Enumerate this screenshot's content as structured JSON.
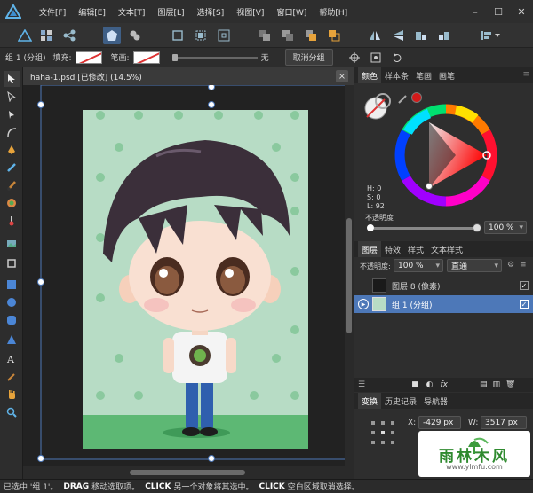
{
  "menu": {
    "items": [
      "文件[F]",
      "编辑[E]",
      "文本[T]",
      "图层[L]",
      "选择[S]",
      "视图[V]",
      "窗口[W]",
      "帮助[H]"
    ],
    "minimize": "–",
    "maximize": "☐",
    "close": "✕"
  },
  "context": {
    "group_label": "组 1 (分组)",
    "fill_label": "填充:",
    "stroke_label": "笔画:",
    "stroke_value": "无",
    "ungroup_button": "取消分组"
  },
  "document": {
    "tab_title": "haha-1.psd [已修改] (14.5%)",
    "close": "×"
  },
  "status": {
    "part1": "已选中 '组 1'。",
    "drag": "DRAG",
    "part2": "移动选取项。",
    "click1": "CLICK",
    "part3": "另一个对象将其选中。",
    "click2": "CLICK",
    "part4": "空白区域取消选择。"
  },
  "color_panel": {
    "tabs": [
      "颜色",
      "样本条",
      "笔画",
      "画笔"
    ],
    "h": "H: 0",
    "s": "S: 0",
    "l": "L: 92",
    "opacity_label": "不透明度",
    "opacity_value": "100 %",
    "opacity_level": 1.0
  },
  "layers_panel": {
    "tabs": [
      "图层",
      "特效",
      "样式",
      "文本样式"
    ],
    "opacity_label": "不透明度:",
    "opacity_value": "100 %",
    "blend_mode": "直通",
    "layers": [
      {
        "name": "图层 8 (像素)",
        "selected": false,
        "checked": true
      },
      {
        "name": "组 1 (分组)",
        "selected": true,
        "checked": true
      }
    ]
  },
  "transform_panel": {
    "tabs": [
      "变换",
      "历史记录",
      "导航器"
    ],
    "x_label": "X:",
    "x_value": "-429 px",
    "w_label": "W:",
    "w_value": "3517 px"
  },
  "watermark": {
    "text": "雨林木风",
    "url": "www.ylmfu.com"
  },
  "colors": {
    "accent": "#5d8fd6",
    "selection_blue": "#4d78b8",
    "canvas_bg": "#b6dcc4"
  }
}
